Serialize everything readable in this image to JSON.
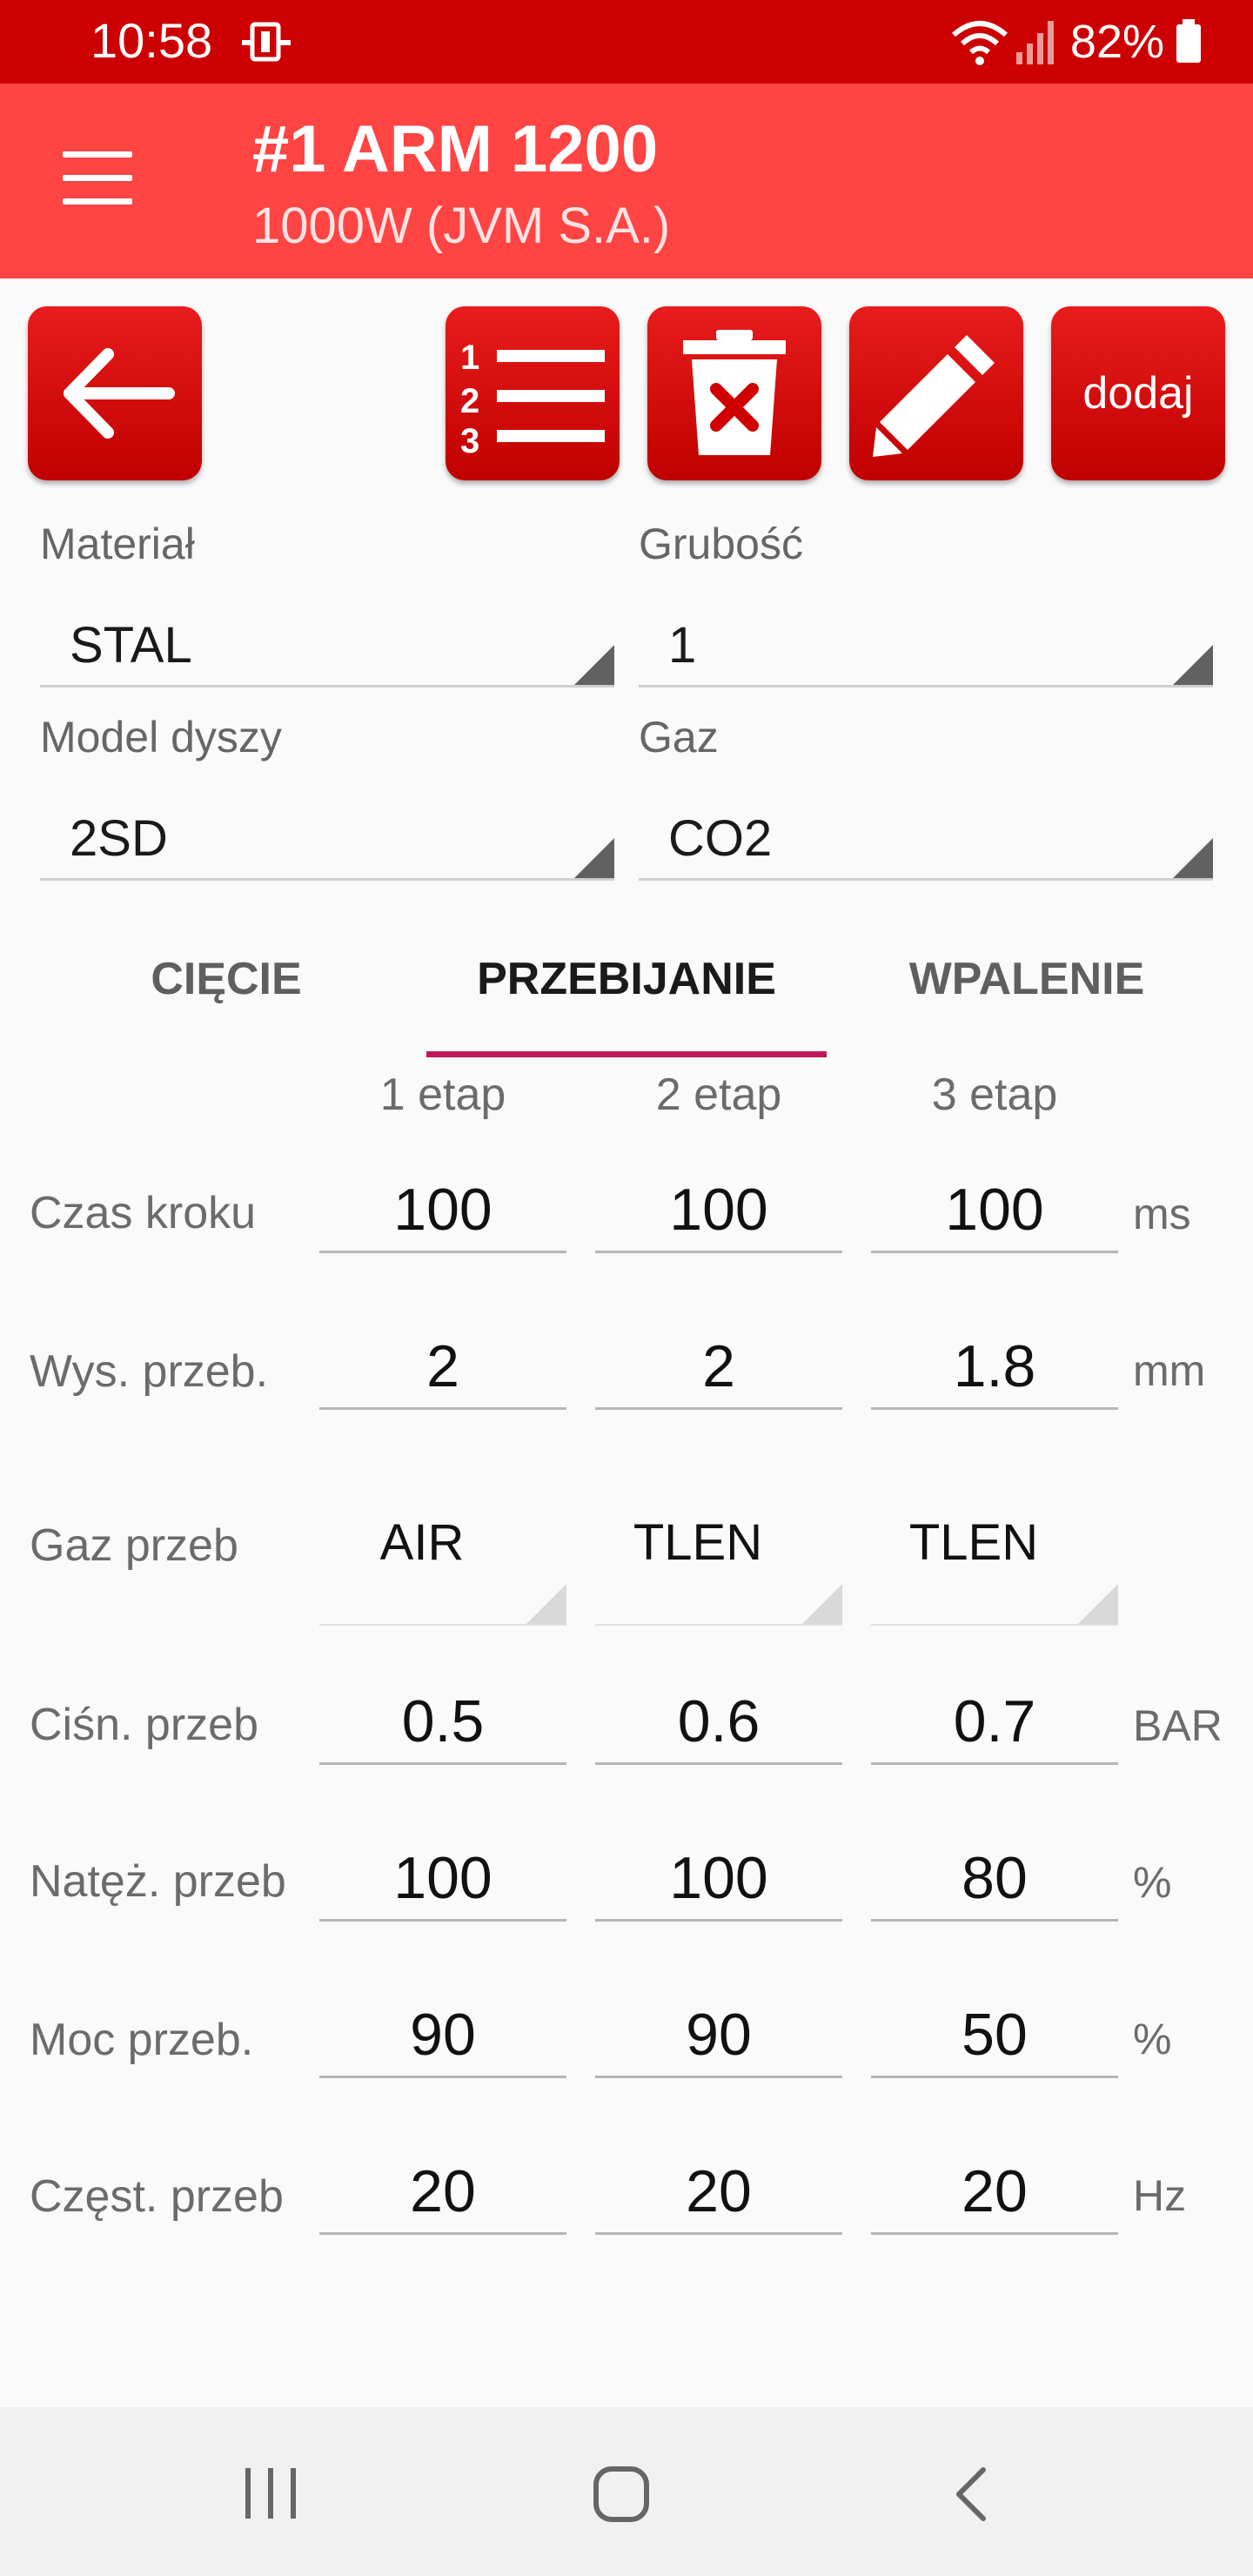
{
  "status_bar": {
    "time": "10:58",
    "battery": "82%"
  },
  "app_bar": {
    "title": "#1 ARM 1200",
    "subtitle": "1000W (JVM S.A.)"
  },
  "toolbar": {
    "add_label": "dodaj"
  },
  "form": {
    "material": {
      "label": "Materiał",
      "value": "STAL"
    },
    "thickness": {
      "label": "Grubość",
      "value": "1"
    },
    "nozzle": {
      "label": "Model dyszy",
      "value": "2SD"
    },
    "gas": {
      "label": "Gaz",
      "value": "CO2"
    }
  },
  "tabs": [
    {
      "label": "CIĘCIE",
      "active": false
    },
    {
      "label": "PRZEBIJANIE",
      "active": true
    },
    {
      "label": "WPALENIE",
      "active": false
    }
  ],
  "columns": [
    "1 etap",
    "2 etap",
    "3 etap"
  ],
  "rows": [
    {
      "label": "Czas kroku",
      "values": [
        "100",
        "100",
        "100"
      ],
      "unit": "ms"
    },
    {
      "label": "Wys. przeb.",
      "values": [
        "2",
        "2",
        "1.8"
      ],
      "unit": "mm"
    },
    {
      "label": "Gaz przeb",
      "values": [
        "AIR",
        "TLEN",
        "TLEN"
      ],
      "unit": ""
    },
    {
      "label": "Ciśn. przeb",
      "values": [
        "0.5",
        "0.6",
        "0.7"
      ],
      "unit": "BAR"
    },
    {
      "label": "Natęż. przeb",
      "values": [
        "100",
        "100",
        "80"
      ],
      "unit": "%"
    },
    {
      "label": "Moc przeb.",
      "values": [
        "90",
        "90",
        "50"
      ],
      "unit": "%"
    },
    {
      "label": "Częst. przeb",
      "values": [
        "20",
        "20",
        "20"
      ],
      "unit": "Hz"
    }
  ],
  "colors": {
    "status_bar": "#cc0000",
    "app_bar": "#ff4444",
    "button": "#e01010",
    "tab_indicator": "#c2185b"
  }
}
